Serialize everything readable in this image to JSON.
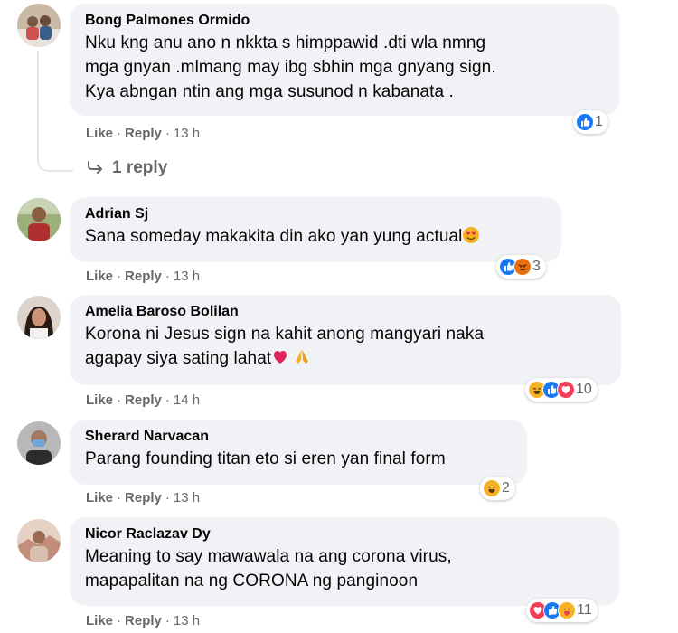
{
  "comments": [
    {
      "author": "Bong Palmones Ormido",
      "lines": [
        "Nku kng anu ano n nkkta s himppawid .dti wla nmng",
        "mga gnyan .mlmang may ibg sbhin mga gnyang sign.",
        "Kya abngan ntin ang mga susunod n kabanata ."
      ],
      "like": "Like",
      "reply": "Reply",
      "time": "13 h",
      "reaction_count": "1",
      "reaction_icons": [
        "like-icon"
      ],
      "view_replies": "1 reply"
    },
    {
      "author": "Adrian Sj",
      "lines": [
        "Sana someday makakita din ako yan yung actual"
      ],
      "like": "Like",
      "reply": "Reply",
      "time": "13 h",
      "reaction_count": "3",
      "reaction_icons": [
        "like-icon",
        "angry-icon"
      ]
    },
    {
      "author": "Amelia Baroso Bolilan",
      "lines": [
        "Korona ni Jesus sign na kahit anong mangyari naka",
        "agapay siya sating lahat"
      ],
      "like": "Like",
      "reply": "Reply",
      "time": "14 h",
      "reaction_count": "10",
      "reaction_icons": [
        "haha-icon",
        "like-icon",
        "love-icon"
      ]
    },
    {
      "author": "Sherard Narvacan",
      "lines": [
        "Parang founding titan eto si eren yan final form"
      ],
      "like": "Like",
      "reply": "Reply",
      "time": "13 h",
      "reaction_count": "2",
      "reaction_icons": [
        "haha-icon"
      ]
    },
    {
      "author": "Nicor Raclazav Dy",
      "lines": [
        "Meaning to say mawawala na ang corona virus,",
        "mapapalitan na ng CORONA ng panginoon"
      ],
      "like": "Like",
      "reply": "Reply",
      "time": "13 h",
      "reaction_count": "11",
      "reaction_icons": [
        "love-icon",
        "like-icon",
        "care-icon"
      ]
    }
  ],
  "colors": {
    "bubble": "#f0f2f5",
    "meta_text": "#65676b",
    "like_blue": "#1877f2",
    "love_red": "#f33e58",
    "haha_yellow": "#f7b125",
    "angry_orange": "#e9710f"
  }
}
